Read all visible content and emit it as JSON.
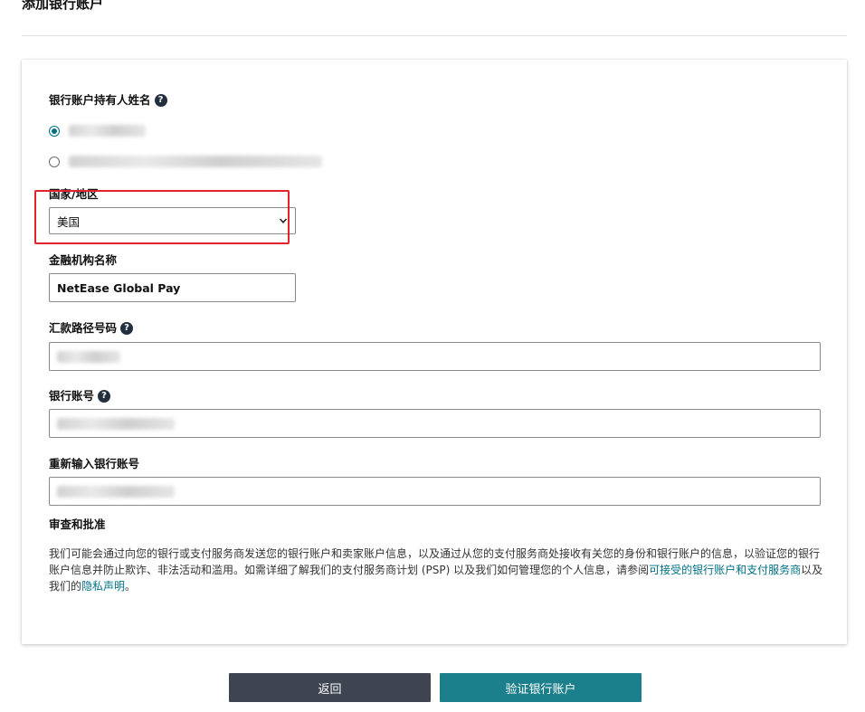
{
  "page": {
    "title": "添加银行账户"
  },
  "holder": {
    "label": "银行账户持有人姓名",
    "options": [
      {
        "checked": true
      },
      {
        "checked": false
      }
    ]
  },
  "country": {
    "label": "国家/地区",
    "value": "美国"
  },
  "institution": {
    "label": "金融机构名称",
    "value": "NetEase Global Pay"
  },
  "routing": {
    "label": "汇款路径号码"
  },
  "account": {
    "label": "银行账号"
  },
  "reenter": {
    "label": "重新输入银行账号"
  },
  "review": {
    "heading": "审查和批准",
    "text_1": "我们可能会通过向您的银行或支付服务商发送您的银行账户和卖家账户信息，以及通过从您的支付服务商处接收有关您的身份和银行账户的信息，以验证您的银行账户信息并防止欺诈、非法活动和滥用。如需详细了解我们的支付服务商计划 (PSP) 以及我们如何管理您的个人信息，请参阅",
    "link_1": "可接受的银行账户和支付服务商",
    "text_2": "以及我们的",
    "link_2": "隐私声明",
    "text_3": "。"
  },
  "buttons": {
    "back": "返回",
    "verify": "验证银行账户"
  },
  "icons": {
    "help": "help-circle-icon",
    "dropdown": "chevron-down-icon"
  },
  "colors": {
    "accent": "#007185",
    "verify_button": "#1b7f8c",
    "back_button": "#3e4551",
    "highlight": "#e5222c"
  }
}
